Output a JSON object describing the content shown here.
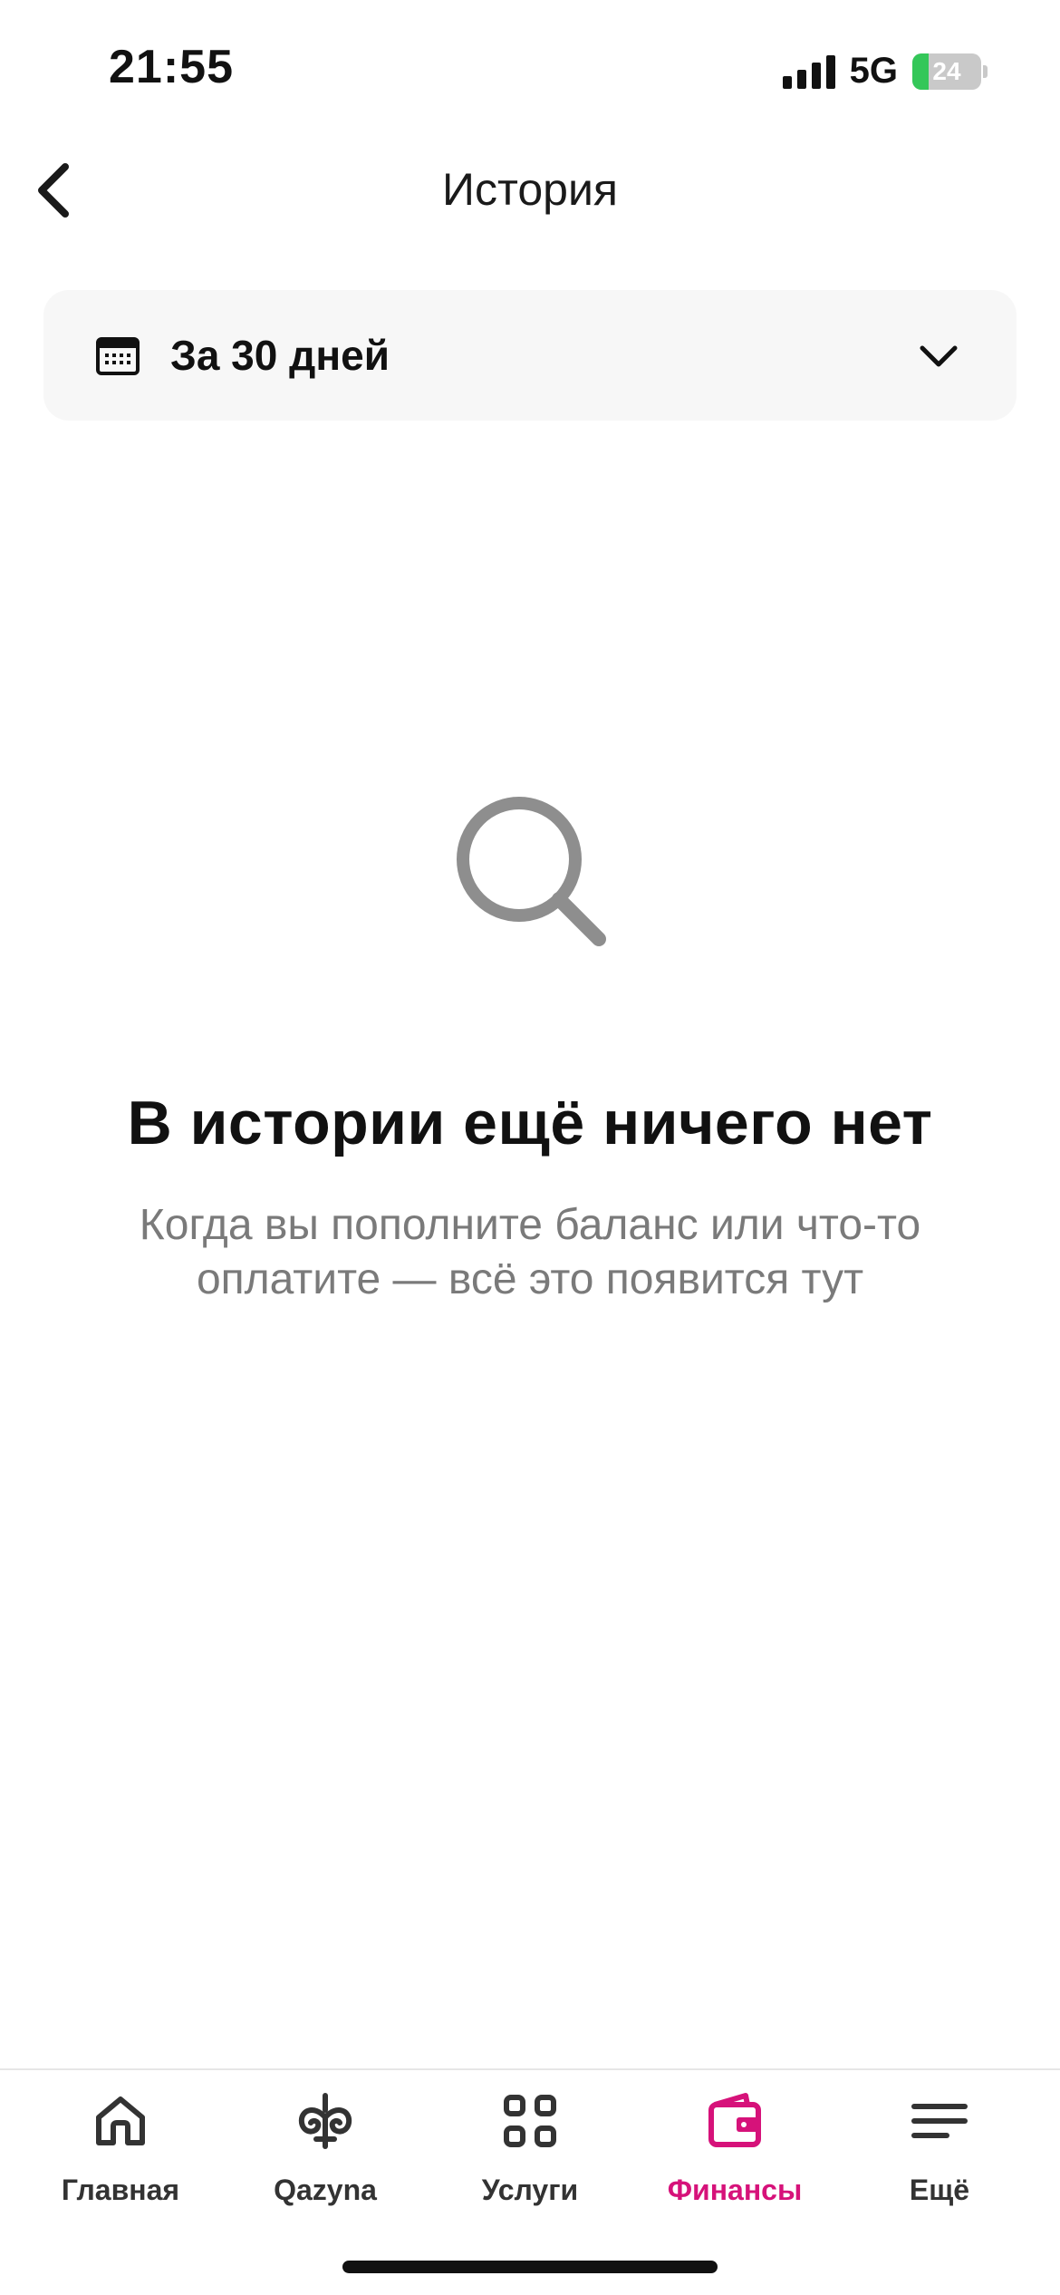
{
  "status_bar": {
    "time": "21:55",
    "network": "5G",
    "battery_level": "24",
    "battery_fraction": 0.24
  },
  "header": {
    "title": "История",
    "back_icon": "chevron-left-icon"
  },
  "filter": {
    "icon": "calendar-icon",
    "label": "За 30 дней",
    "dropdown_icon": "chevron-down-icon"
  },
  "empty_state": {
    "icon": "search-icon",
    "title": "В истории ещё ничего нет",
    "description": "Когда вы пополните баланс или что-то оплатите — всё это появится тут"
  },
  "tab_bar": {
    "items": [
      {
        "label": "Главная",
        "icon": "home-icon",
        "active": false
      },
      {
        "label": "Qazyna",
        "icon": "ornament-icon",
        "active": false
      },
      {
        "label": "Услуги",
        "icon": "grid-icon",
        "active": false
      },
      {
        "label": "Финансы",
        "icon": "wallet-icon",
        "active": true
      },
      {
        "label": "Ещё",
        "icon": "menu-icon",
        "active": false
      }
    ]
  },
  "colors": {
    "accent": "#d6127a",
    "muted_text": "#7a7a7a",
    "icon_gray": "#8e8e8e",
    "filter_bg": "#f7f7f7",
    "battery_green": "#34c759"
  }
}
